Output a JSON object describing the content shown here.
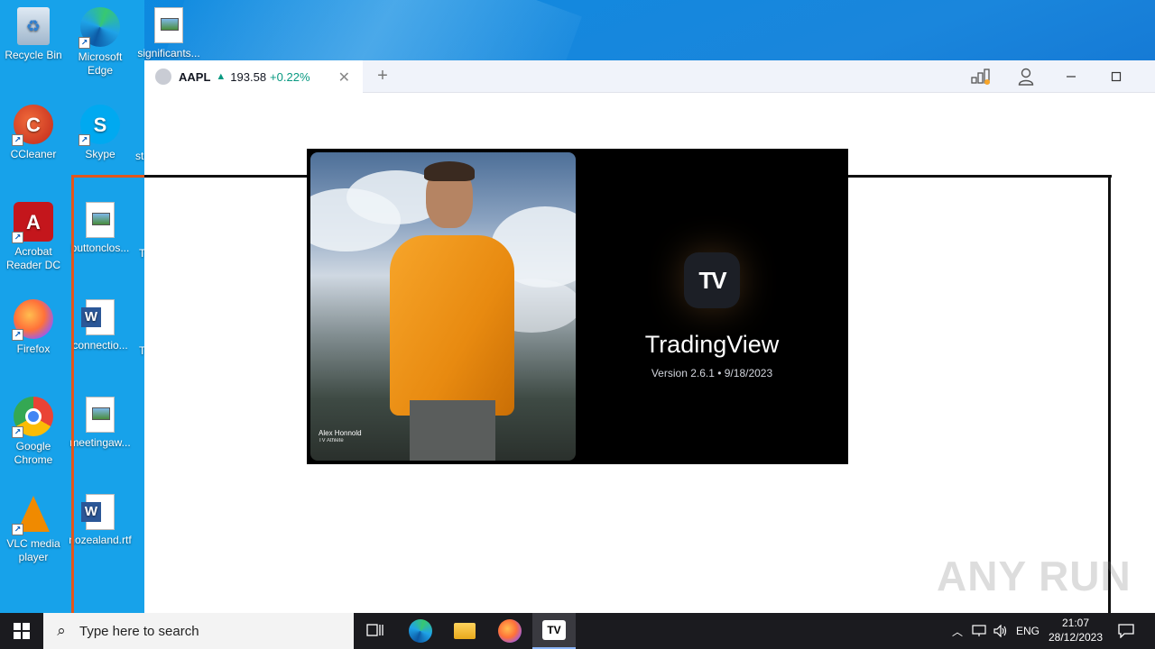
{
  "desktop": {
    "icons": [
      {
        "label": "Recycle Bin"
      },
      {
        "label": "Microsoft Edge"
      },
      {
        "label": "significants..."
      },
      {
        "label": "CCleaner"
      },
      {
        "label": "Skype"
      },
      {
        "label": "st"
      },
      {
        "label": "Acrobat Reader DC"
      },
      {
        "label": "buttonclos..."
      },
      {
        "label": "T"
      },
      {
        "label": "Firefox"
      },
      {
        "label": "connectio..."
      },
      {
        "label": "T"
      },
      {
        "label": "Google Chrome"
      },
      {
        "label": "meetingaw..."
      },
      {
        "label": "VLC media player"
      },
      {
        "label": "nozealand.rtf"
      }
    ]
  },
  "app": {
    "tab": {
      "symbol": "AAPL",
      "direction": "▲",
      "price": "193.58",
      "change": "+0.22%",
      "close": "✕"
    },
    "new_tab": "+",
    "splash": {
      "name": "TradingView",
      "version": "Version 2.6.1 • 9/18/2023",
      "logo_text": "TV",
      "photo_caption": "Alex Honnold",
      "photo_sub": "TV Athlete"
    }
  },
  "watermark": "ANY RUN",
  "taskbar": {
    "search_placeholder": "Type here to search",
    "language": "ENG",
    "time": "21:07",
    "date": "28/12/2023"
  },
  "colors": {
    "accent_green": "#089981",
    "orange_line": "#e2561b",
    "taskbar_bg": "#1b1b1f"
  }
}
